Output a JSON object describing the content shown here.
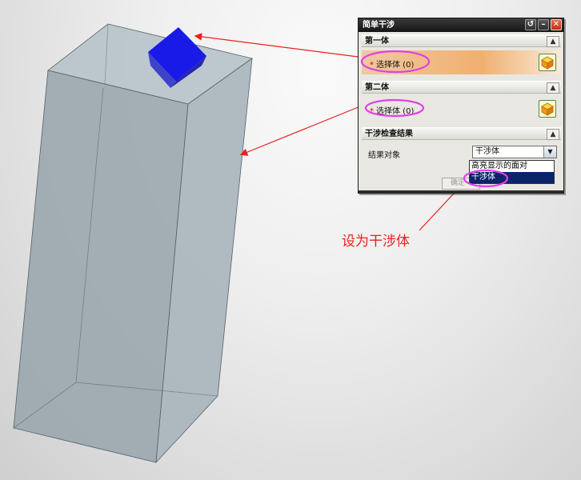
{
  "dialog": {
    "title": "简单干涉",
    "section1": {
      "header": "第一体",
      "selector_label": "选择体 (0)"
    },
    "section2": {
      "header": "第二体",
      "selector_label": "选择体 (0)"
    },
    "section3": {
      "header": "干涉检查结果",
      "dropdown_label": "结果对象",
      "dropdown_value": "干涉体",
      "options": [
        "高亮显示的面对",
        "干涉体"
      ],
      "selected_option": "干涉体"
    },
    "ok_label": "确定"
  },
  "annotation": {
    "text": "设为干涉体"
  },
  "colors": {
    "annotation_red": "#e8211d",
    "highlight_magenta": "#e040e8",
    "cube_blue": "#1010e8"
  }
}
